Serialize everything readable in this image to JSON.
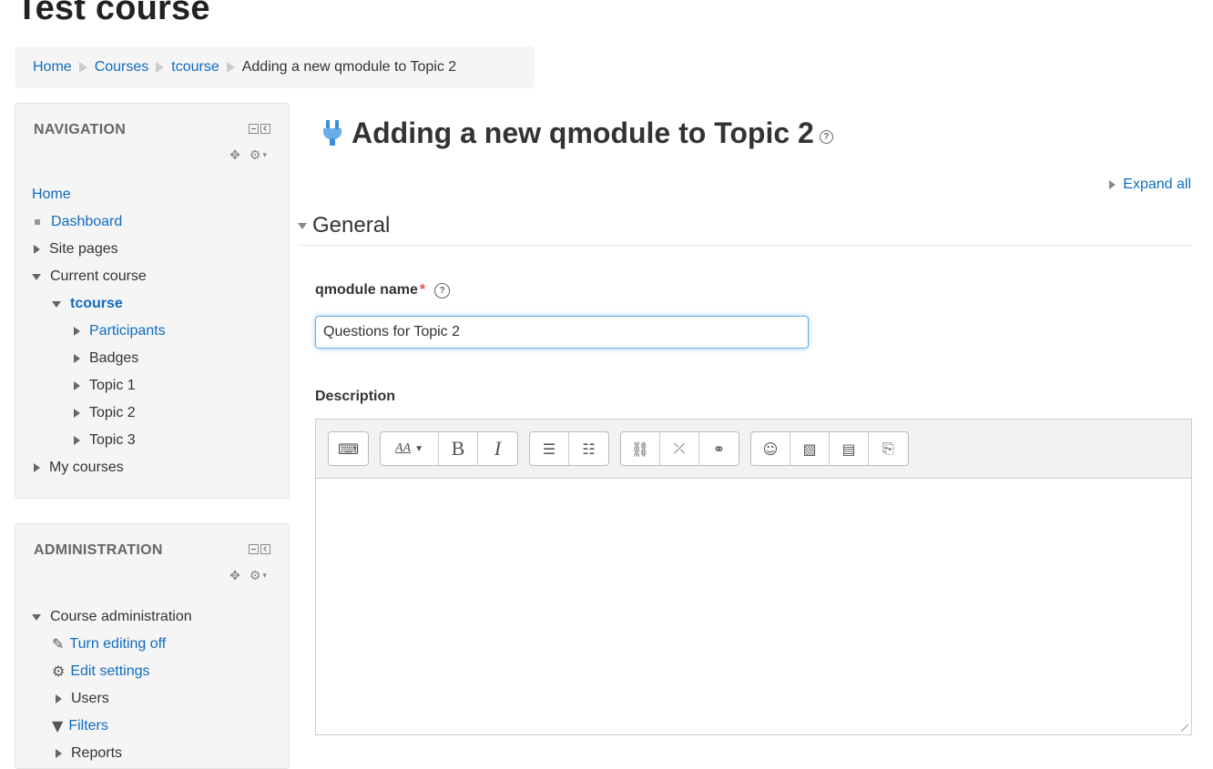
{
  "course_title": "Test course",
  "breadcrumb": [
    "Home",
    "Courses",
    "tcourse",
    "Adding a new qmodule to Topic 2"
  ],
  "navigation": {
    "title": "NAVIGATION",
    "items": {
      "home": "Home",
      "dashboard": "Dashboard",
      "site_pages": "Site pages",
      "current_course": "Current course",
      "course": "tcourse",
      "participants": "Participants",
      "badges": "Badges",
      "topic1": "Topic 1",
      "topic2": "Topic 2",
      "topic3": "Topic 3",
      "my_courses": "My courses"
    }
  },
  "administration": {
    "title": "ADMINISTRATION",
    "items": {
      "course_admin": "Course administration",
      "turn_editing_off": "Turn editing off",
      "edit_settings": "Edit settings",
      "users": "Users",
      "filters": "Filters",
      "reports": "Reports"
    }
  },
  "main": {
    "heading": "Adding a new qmodule to Topic 2",
    "expand_all": "Expand all",
    "section_general": "General",
    "name_label": "qmodule name",
    "required_mark": "*",
    "name_value": "Questions for Topic 2",
    "description_label": "Description"
  },
  "editor_toolbar": {
    "font_style": "AA",
    "bold": "B",
    "italic": "I"
  },
  "icons": {
    "collapse": "collapse-icon",
    "plugin": "plugin-icon",
    "help": "help-icon"
  },
  "colors": {
    "link": "#0f6cbf",
    "required": "#d9534f",
    "focus": "#66afe9"
  }
}
